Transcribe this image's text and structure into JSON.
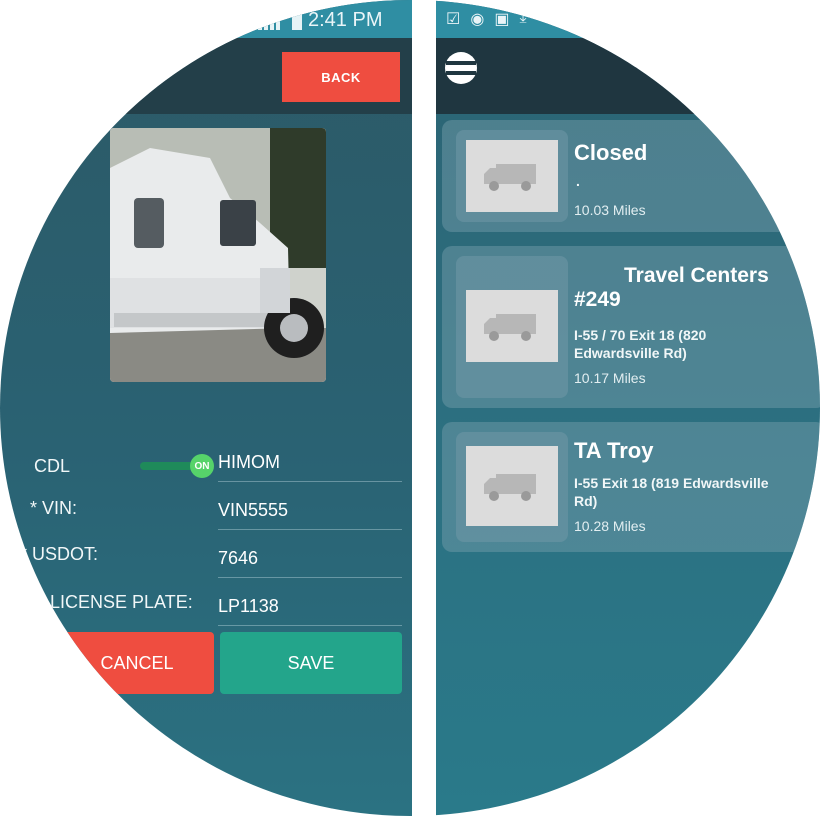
{
  "left_screen": {
    "status_bar": {
      "time": "2:41 PM"
    },
    "header": {
      "back_label": "BACK"
    },
    "form": {
      "cdl": {
        "label": "CDL",
        "toggle_text": "ON",
        "value": "HIMOM"
      },
      "vin": {
        "label": "* VIN:",
        "value": "VIN5555"
      },
      "usdot": {
        "label": "* USDOT:",
        "value": "7646"
      },
      "license_plate": {
        "label": "LICENSE PLATE:",
        "value": "LP1138"
      }
    },
    "buttons": {
      "cancel_label": "CANCEL",
      "save_label": "SAVE"
    }
  },
  "right_screen": {
    "status_icons": [
      "person-icon",
      "location-icon",
      "sim-icon",
      "download-icon"
    ],
    "locations": [
      {
        "name": "Closed",
        "address": ".",
        "distance": "10.03 Miles"
      },
      {
        "name": "Travel Centers #249",
        "name_line1": "Travel Centers",
        "name_line2": "#249",
        "address_line1": "I-55 / 70 Exit 18 (820",
        "address_line2": "Edwardsville Rd)",
        "distance": "10.17 Miles"
      },
      {
        "name": "TA Troy",
        "address_line1": "I-55 Exit 18 (819 Edwardsville",
        "address_line2": "Rd)",
        "distance": "10.28 Miles"
      }
    ]
  },
  "colors": {
    "accent_red": "#ef4d40",
    "accent_green": "#23a58b",
    "panel_teal": "#2a6273",
    "status_bar": "#2f8ea3"
  }
}
